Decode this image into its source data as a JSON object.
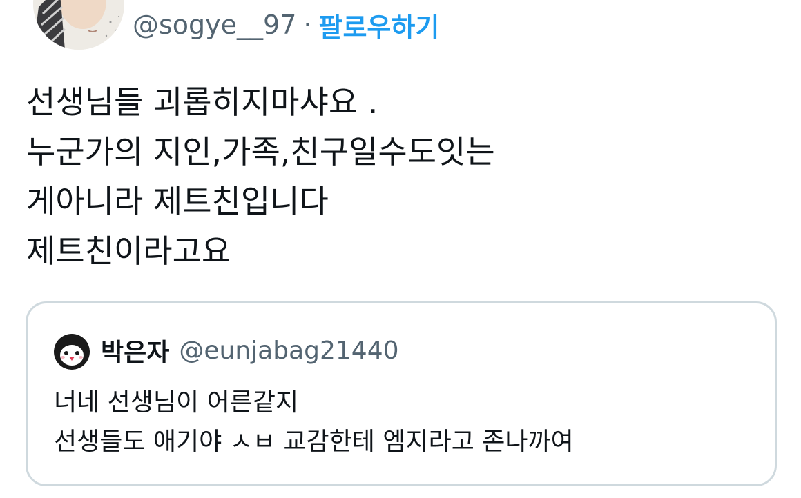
{
  "tweet": {
    "author": {
      "handle": "@sogye__97",
      "separator": "·",
      "follow_label": "팔로우하기",
      "avatar_icon": "user-avatar-icon"
    },
    "body_lines": [
      "선생님들 괴롭히지마샤요  .",
      "누군가의 지인,가족,친구일수도잇는",
      "게아니라 제트친입니다",
      "제트친이라고요"
    ]
  },
  "quoted_tweet": {
    "author": {
      "name": "박은자",
      "handle": "@eunjabag21440",
      "avatar_icon": "penguin-avatar-icon"
    },
    "body_lines": [
      "너네 선생님이 어른같지",
      "선생들도 애기야 ㅅㅂ 교감한테 엠지라고 존나까여"
    ]
  },
  "colors": {
    "text_primary": "#0f1419",
    "text_secondary": "#536471",
    "accent": "#1d9bf0",
    "border": "#cfd9de"
  }
}
